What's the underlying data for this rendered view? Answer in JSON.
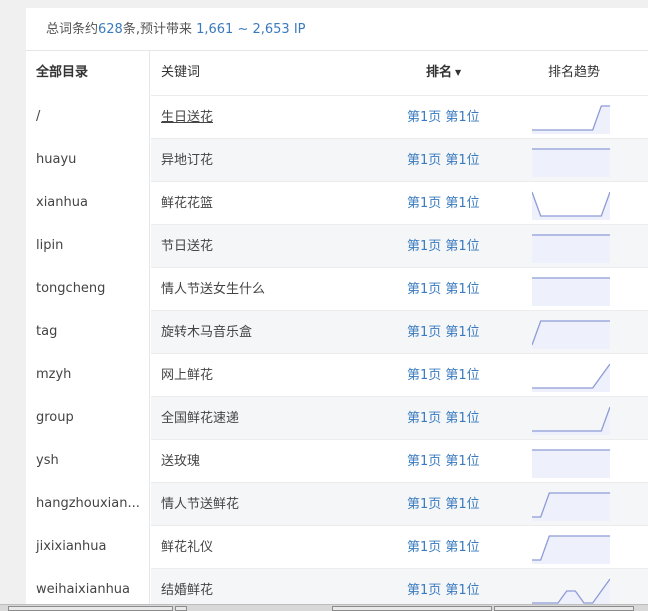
{
  "summary": {
    "prefix": "总词条约",
    "count": "628",
    "mid": "条,预计带来 ",
    "ip_range": "1,661 ~ 2,653 IP"
  },
  "sidebar": {
    "header": "全部目录",
    "items": [
      "/",
      "huayu",
      "xianhua",
      "lipin",
      "tongcheng",
      "tag",
      "mzyh",
      "group",
      "ysh",
      "hangzhouxian...",
      "jixixianhua",
      "weihaixianhua"
    ]
  },
  "table": {
    "col_keyword": "关键词",
    "col_rank": "排名",
    "col_rank_arrow": "▼",
    "col_trend": "排名趋势",
    "rows": [
      {
        "keyword": "生日送花",
        "rank": "第1页 第1位",
        "trend": [
          0,
          0,
          0,
          0,
          0,
          0,
          0,
          0,
          1,
          1
        ]
      },
      {
        "keyword": "异地订花",
        "rank": "第1页 第1位",
        "trend": [
          1,
          1,
          1,
          1,
          1,
          1,
          1,
          1,
          1,
          1
        ]
      },
      {
        "keyword": "鲜花花篮",
        "rank": "第1页 第1位",
        "trend": [
          1,
          0,
          0,
          0,
          0,
          0,
          0,
          0,
          0,
          1
        ]
      },
      {
        "keyword": "节日送花",
        "rank": "第1页 第1位",
        "trend": [
          1,
          1,
          1,
          1,
          1,
          1,
          1,
          1,
          1,
          1
        ]
      },
      {
        "keyword": "情人节送女生什么",
        "rank": "第1页 第1位",
        "trend": [
          1,
          1,
          1,
          1,
          1,
          1,
          1,
          1,
          1,
          1
        ]
      },
      {
        "keyword": "旋转木马音乐盒",
        "rank": "第1页 第1位",
        "trend": [
          0,
          1,
          1,
          1,
          1,
          1,
          1,
          1,
          1,
          1
        ]
      },
      {
        "keyword": "网上鲜花",
        "rank": "第1页 第1位",
        "trend": [
          0,
          0,
          0,
          0,
          0,
          0,
          0,
          0,
          0.5,
          1
        ]
      },
      {
        "keyword": "全国鲜花速递",
        "rank": "第1页 第1位",
        "trend": [
          0,
          0,
          0,
          0,
          0,
          0,
          0,
          0,
          0,
          1
        ]
      },
      {
        "keyword": "送玫瑰",
        "rank": "第1页 第1位",
        "trend": [
          1,
          1,
          1,
          1,
          1,
          1,
          1,
          1,
          1,
          1
        ]
      },
      {
        "keyword": "情人节送鲜花",
        "rank": "第1页 第1位",
        "trend": [
          0,
          0,
          1,
          1,
          1,
          1,
          1,
          1,
          1,
          1
        ]
      },
      {
        "keyword": "鲜花礼仪",
        "rank": "第1页 第1位",
        "trend": [
          0,
          0,
          1,
          1,
          1,
          1,
          1,
          1,
          1,
          1
        ]
      },
      {
        "keyword": "结婚鲜花",
        "rank": "第1页 第1位",
        "trend": [
          0,
          0,
          0,
          0,
          0.5,
          0.5,
          0,
          0,
          0.5,
          1
        ]
      }
    ]
  },
  "colors": {
    "link": "#3a7bbf",
    "trend_line": "#8e9bd6",
    "trend_fill": "#eef0fb"
  }
}
